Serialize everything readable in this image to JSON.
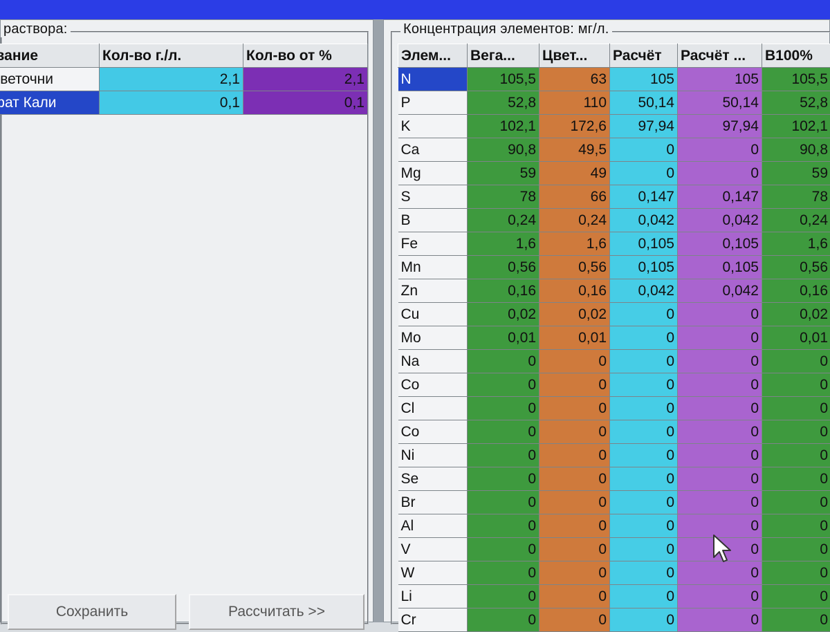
{
  "left": {
    "group_title": "раствора:",
    "columns": [
      "нование",
      "Кол-во г./л.",
      "Кол-во от %"
    ],
    "rows": [
      {
        "name": "я Цветочни",
        "qty_gl": "2,1",
        "qty_pct": "2,1",
        "selected": false
      },
      {
        "name": "осфат Кали",
        "qty_gl": "0,1",
        "qty_pct": "0,1",
        "selected": true
      }
    ],
    "buttons": {
      "save": "Сохранить",
      "calculate": "Рассчитать >>"
    }
  },
  "right": {
    "group_title": "Концентрация элементов: мг/л.",
    "columns": [
      "Элем...",
      "Вега...",
      "Цвет...",
      "Расчёт",
      "Расчёт ...",
      "В100%"
    ],
    "rows": [
      {
        "el": "N",
        "vals": [
          "105,5",
          "63",
          "105",
          "105",
          "105,5"
        ],
        "selected": true
      },
      {
        "el": "P",
        "vals": [
          "52,8",
          "110",
          "50,14",
          "50,14",
          "52,8"
        ]
      },
      {
        "el": "K",
        "vals": [
          "102,1",
          "172,6",
          "97,94",
          "97,94",
          "102,1"
        ]
      },
      {
        "el": "Ca",
        "vals": [
          "90,8",
          "49,5",
          "0",
          "0",
          "90,8"
        ]
      },
      {
        "el": "Mg",
        "vals": [
          "59",
          "49",
          "0",
          "0",
          "59"
        ]
      },
      {
        "el": "S",
        "vals": [
          "78",
          "66",
          "0,147",
          "0,147",
          "78"
        ]
      },
      {
        "el": "B",
        "vals": [
          "0,24",
          "0,24",
          "0,042",
          "0,042",
          "0,24"
        ]
      },
      {
        "el": "Fe",
        "vals": [
          "1,6",
          "1,6",
          "0,105",
          "0,105",
          "1,6"
        ]
      },
      {
        "el": "Mn",
        "vals": [
          "0,56",
          "0,56",
          "0,105",
          "0,105",
          "0,56"
        ]
      },
      {
        "el": "Zn",
        "vals": [
          "0,16",
          "0,16",
          "0,042",
          "0,042",
          "0,16"
        ]
      },
      {
        "el": "Cu",
        "vals": [
          "0,02",
          "0,02",
          "0",
          "0",
          "0,02"
        ]
      },
      {
        "el": "Mo",
        "vals": [
          "0,01",
          "0,01",
          "0",
          "0",
          "0,01"
        ]
      },
      {
        "el": "Na",
        "vals": [
          "0",
          "0",
          "0",
          "0",
          "0"
        ]
      },
      {
        "el": "Co",
        "vals": [
          "0",
          "0",
          "0",
          "0",
          "0"
        ]
      },
      {
        "el": "Cl",
        "vals": [
          "0",
          "0",
          "0",
          "0",
          "0"
        ]
      },
      {
        "el": "Co",
        "vals": [
          "0",
          "0",
          "0",
          "0",
          "0"
        ]
      },
      {
        "el": "Ni",
        "vals": [
          "0",
          "0",
          "0",
          "0",
          "0"
        ]
      },
      {
        "el": "Se",
        "vals": [
          "0",
          "0",
          "0",
          "0",
          "0"
        ]
      },
      {
        "el": "Br",
        "vals": [
          "0",
          "0",
          "0",
          "0",
          "0"
        ]
      },
      {
        "el": "Al",
        "vals": [
          "0",
          "0",
          "0",
          "0",
          "0"
        ]
      },
      {
        "el": "V",
        "vals": [
          "0",
          "0",
          "0",
          "0",
          "0"
        ]
      },
      {
        "el": "W",
        "vals": [
          "0",
          "0",
          "0",
          "0",
          "0"
        ]
      },
      {
        "el": "Li",
        "vals": [
          "0",
          "0",
          "0",
          "0",
          "0"
        ]
      },
      {
        "el": "Cr",
        "vals": [
          "0",
          "0",
          "0",
          "0",
          "0"
        ]
      }
    ]
  },
  "colors": {
    "title_bar": "#2b3de6",
    "selection": "#2447c8",
    "veg_column": "#3e9a3e",
    "flower_column": "#cf7a3c",
    "calc_column": "#46cde6",
    "calc2_column": "#9a4ec2",
    "b100_column": "#3e9a3e"
  },
  "icons": {
    "cursor": "mouse-pointer-icon"
  }
}
